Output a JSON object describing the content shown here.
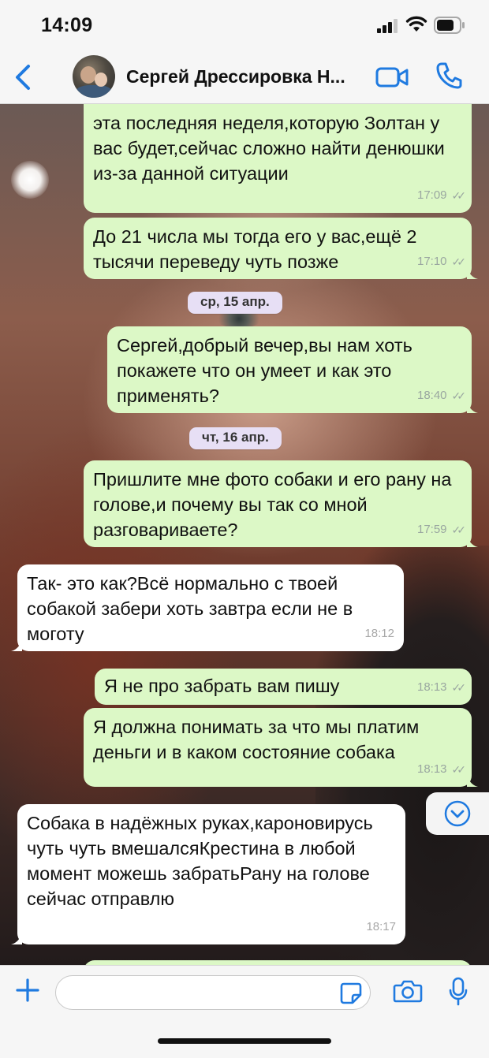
{
  "status_bar": {
    "time": "14:09"
  },
  "header": {
    "contact_name": "Сергей Дрессировка Н...",
    "accent_color": "#1f7ae0"
  },
  "messages": [
    {
      "direction": "out",
      "text": "эта последняя неделя,которую Золтан у вас будет,сейчас сложно найти денюшки из-за данной ситуации",
      "time": "17:09",
      "read": true
    },
    {
      "direction": "out",
      "text": "До 21 числа мы тогда его у вас,ещё 2 тысячи переведу чуть позже",
      "time": "17:10",
      "read": true
    },
    {
      "direction": "out",
      "text": "Сергей,добрый вечер,вы нам хоть покажете что он умеет и как это применять?",
      "time": "18:40",
      "read": true
    },
    {
      "direction": "out",
      "text": "Пришлите мне фото собаки и его рану на голове,и почему вы так со мной разговариваете?",
      "time": "17:59",
      "read": true
    },
    {
      "direction": "in",
      "text": "Так- это как?Всё нормально с твоей собакой забери хоть завтра если не в моготу",
      "time": "18:12"
    },
    {
      "direction": "out",
      "text": "Я не про забрать вам пишу",
      "time": "18:13",
      "read": true
    },
    {
      "direction": "out",
      "text": "Я должна понимать за что мы платим деньги и в каком состояние собака",
      "time": "18:13",
      "read": true
    },
    {
      "direction": "in",
      "text": "Собака в надёжных руках,кароновирусь чуть чуть вмешалсяКрестина в любой момент можешь забратьРану на голове сейчас отправлю",
      "time": "18:17"
    }
  ],
  "date_separators": [
    "ср, 15 апр.",
    "чт, 16 апр."
  ],
  "input": {
    "value": "",
    "placeholder": ""
  },
  "colors": {
    "outgoing_bubble": "#dcf8c6",
    "incoming_bubble": "#ffffff",
    "date_pill": "#e7dff5"
  }
}
